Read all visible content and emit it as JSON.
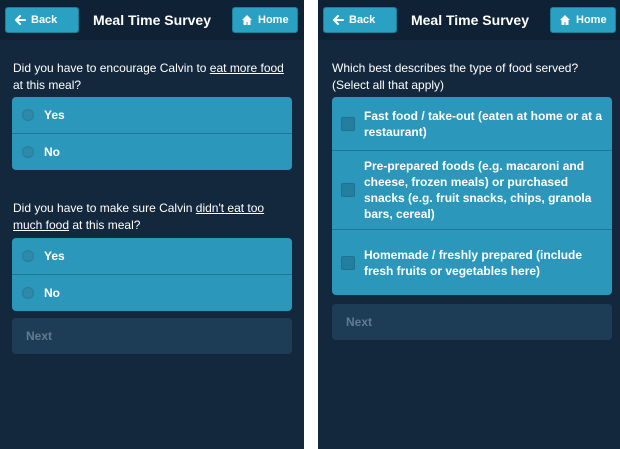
{
  "left_screen": {
    "header": {
      "title": "Meal Time Survey",
      "back_label": "Back",
      "home_label": "Home"
    },
    "q1": {
      "text_before": "Did you have to encourage Calvin to ",
      "text_underlined": "eat more food",
      "text_after": " at this meal?",
      "options": [
        "Yes",
        "No"
      ]
    },
    "q2": {
      "text_before": "Did you have to make sure Calvin ",
      "text_underlined": "didn't eat too much food",
      "text_after": " at this meal?",
      "options": [
        "Yes",
        "No"
      ]
    },
    "next_label": "Next"
  },
  "right_screen": {
    "header": {
      "title": "Meal Time Survey",
      "back_label": "Back",
      "home_label": "Home"
    },
    "question": "Which best describes the type of food served? (Select all that apply)",
    "options": [
      "Fast food / take-out (eaten at home or at a restaurant)",
      "Pre-prepared foods (e.g. macaroni and cheese, frozen meals) or purchased snacks (e.g. fruit snacks, chips, granola bars, cereal)",
      "Homemade / freshly prepared (include fresh fruits or vegetables here)"
    ],
    "next_label": "Next"
  },
  "colors": {
    "screen_bg": "#14283d",
    "header_bg": "#0f2134",
    "button_blue": "#2aa0c3",
    "option_blue": "#2a97bb",
    "next_disabled": "#1d3d56"
  },
  "icons": {
    "back": "arrow-left-icon",
    "home": "home-icon"
  }
}
